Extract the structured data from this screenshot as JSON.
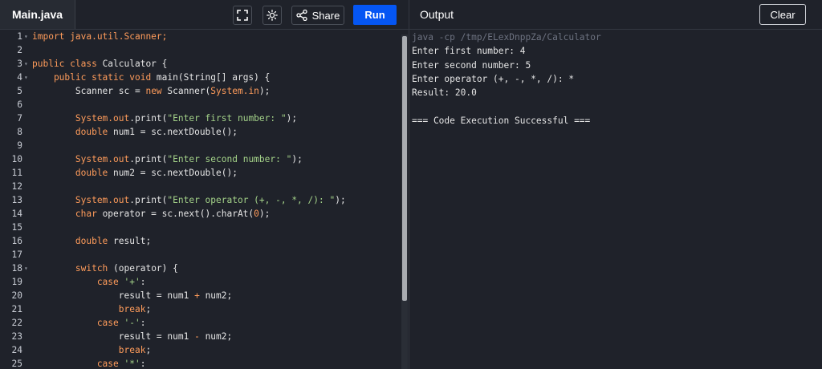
{
  "header": {
    "file_tab": "Main.java",
    "share_label": "Share",
    "run_label": "Run",
    "output_title": "Output",
    "clear_label": "Clear"
  },
  "editor": {
    "lines": [
      {
        "num": "1",
        "fold": true,
        "tokens": [
          {
            "t": "import java.util.Scanner;",
            "c": "kw"
          }
        ]
      },
      {
        "num": "2",
        "fold": false,
        "tokens": []
      },
      {
        "num": "3",
        "fold": true,
        "tokens": [
          {
            "t": "public class ",
            "c": "kw"
          },
          {
            "t": "Calculator {",
            "c": ""
          }
        ]
      },
      {
        "num": "4",
        "fold": true,
        "tokens": [
          {
            "t": "    public static void ",
            "c": "kw"
          },
          {
            "t": "main(String[] args) {",
            "c": ""
          }
        ]
      },
      {
        "num": "5",
        "fold": false,
        "tokens": [
          {
            "t": "        Scanner sc = ",
            "c": ""
          },
          {
            "t": "new ",
            "c": "kw"
          },
          {
            "t": "Scanner(",
            "c": ""
          },
          {
            "t": "System.in",
            "c": "kw"
          },
          {
            "t": ");",
            "c": ""
          }
        ]
      },
      {
        "num": "6",
        "fold": false,
        "tokens": []
      },
      {
        "num": "7",
        "fold": false,
        "tokens": [
          {
            "t": "        System.out",
            "c": "kw"
          },
          {
            "t": ".print(",
            "c": ""
          },
          {
            "t": "\"Enter first number: \"",
            "c": "str"
          },
          {
            "t": ");",
            "c": ""
          }
        ]
      },
      {
        "num": "8",
        "fold": false,
        "tokens": [
          {
            "t": "        double ",
            "c": "kw"
          },
          {
            "t": "num1 = sc.nextDouble();",
            "c": ""
          }
        ]
      },
      {
        "num": "9",
        "fold": false,
        "tokens": []
      },
      {
        "num": "10",
        "fold": false,
        "tokens": [
          {
            "t": "        System.out",
            "c": "kw"
          },
          {
            "t": ".print(",
            "c": ""
          },
          {
            "t": "\"Enter second number: \"",
            "c": "str"
          },
          {
            "t": ");",
            "c": ""
          }
        ]
      },
      {
        "num": "11",
        "fold": false,
        "tokens": [
          {
            "t": "        double ",
            "c": "kw"
          },
          {
            "t": "num2 = sc.nextDouble();",
            "c": ""
          }
        ]
      },
      {
        "num": "12",
        "fold": false,
        "tokens": []
      },
      {
        "num": "13",
        "fold": false,
        "tokens": [
          {
            "t": "        System.out",
            "c": "kw"
          },
          {
            "t": ".print(",
            "c": ""
          },
          {
            "t": "\"Enter operator (+, -, *, /): \"",
            "c": "str"
          },
          {
            "t": ");",
            "c": ""
          }
        ]
      },
      {
        "num": "14",
        "fold": false,
        "tokens": [
          {
            "t": "        char ",
            "c": "kw"
          },
          {
            "t": "operator = sc.next().charAt(",
            "c": ""
          },
          {
            "t": "0",
            "c": "num"
          },
          {
            "t": ");",
            "c": ""
          }
        ]
      },
      {
        "num": "15",
        "fold": false,
        "tokens": []
      },
      {
        "num": "16",
        "fold": false,
        "tokens": [
          {
            "t": "        double ",
            "c": "kw"
          },
          {
            "t": "result;",
            "c": ""
          }
        ]
      },
      {
        "num": "17",
        "fold": false,
        "tokens": []
      },
      {
        "num": "18",
        "fold": true,
        "tokens": [
          {
            "t": "        switch ",
            "c": "kw"
          },
          {
            "t": "(operator) {",
            "c": ""
          }
        ]
      },
      {
        "num": "19",
        "fold": false,
        "tokens": [
          {
            "t": "            case ",
            "c": "kw"
          },
          {
            "t": "'+'",
            "c": "str"
          },
          {
            "t": ":",
            "c": ""
          }
        ]
      },
      {
        "num": "20",
        "fold": false,
        "tokens": [
          {
            "t": "                result = num1 ",
            "c": ""
          },
          {
            "t": "+",
            "c": "kw"
          },
          {
            "t": " num2;",
            "c": ""
          }
        ]
      },
      {
        "num": "21",
        "fold": false,
        "tokens": [
          {
            "t": "                break",
            "c": "kw"
          },
          {
            "t": ";",
            "c": ""
          }
        ]
      },
      {
        "num": "22",
        "fold": false,
        "tokens": [
          {
            "t": "            case ",
            "c": "kw"
          },
          {
            "t": "'-'",
            "c": "str"
          },
          {
            "t": ":",
            "c": ""
          }
        ]
      },
      {
        "num": "23",
        "fold": false,
        "tokens": [
          {
            "t": "                result = num1 ",
            "c": ""
          },
          {
            "t": "-",
            "c": "kw"
          },
          {
            "t": " num2;",
            "c": ""
          }
        ]
      },
      {
        "num": "24",
        "fold": false,
        "tokens": [
          {
            "t": "                break",
            "c": "kw"
          },
          {
            "t": ";",
            "c": ""
          }
        ]
      },
      {
        "num": "25",
        "fold": false,
        "tokens": [
          {
            "t": "            case ",
            "c": "kw"
          },
          {
            "t": "'*'",
            "c": "str"
          },
          {
            "t": ":",
            "c": ""
          }
        ]
      }
    ]
  },
  "output": {
    "lines": [
      {
        "text": "java -cp /tmp/ELexDnppZa/Calculator",
        "dim": true
      },
      {
        "text": "Enter first number: 4",
        "dim": false
      },
      {
        "text": "Enter second number: 5",
        "dim": false
      },
      {
        "text": "Enter operator (+, -, *, /): *",
        "dim": false
      },
      {
        "text": "Result: 20.0",
        "dim": false
      },
      {
        "text": "",
        "dim": false
      },
      {
        "text": "=== Code Execution Successful ===",
        "dim": false
      }
    ]
  },
  "colors": {
    "background": "#1f222a",
    "run_button": "#0556f3",
    "keyword": "#ff9c5b",
    "string": "#a4d389"
  },
  "icons": [
    "fullscreen-icon",
    "theme-toggle-icon",
    "share-icon",
    "fold-arrow-icon"
  ]
}
